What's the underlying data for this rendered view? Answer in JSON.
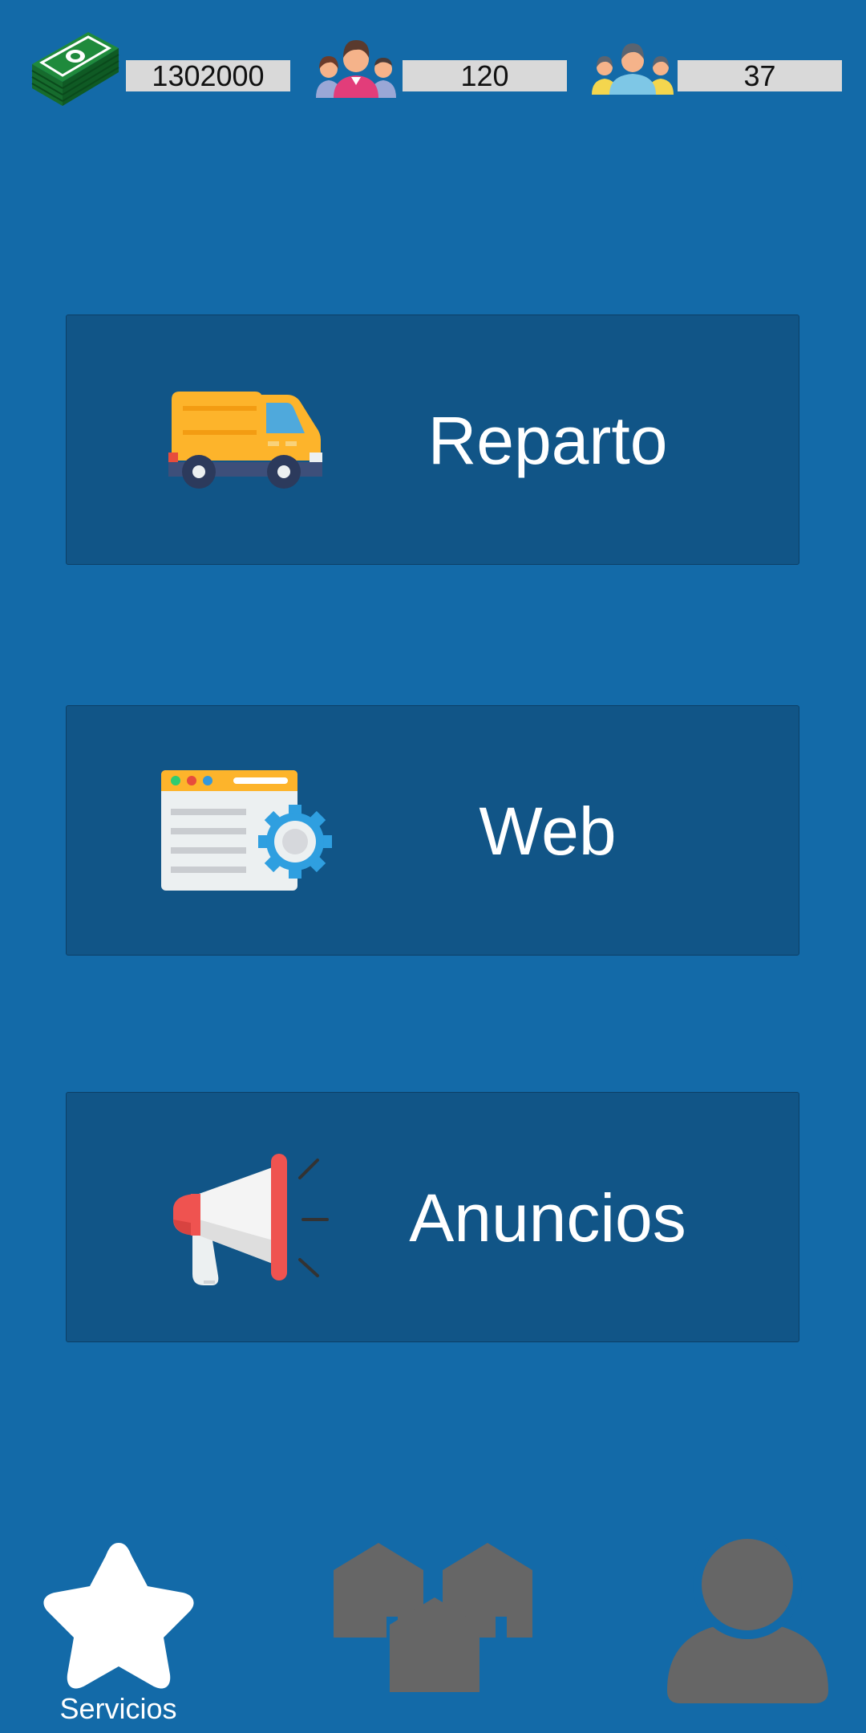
{
  "stats": {
    "money": {
      "value": "1302000",
      "icon": "money-stack-icon"
    },
    "employees": {
      "value": "120",
      "icon": "employees-icon"
    },
    "clients": {
      "value": "37",
      "icon": "clients-group-icon"
    }
  },
  "services": [
    {
      "label": "Reparto",
      "icon": "delivery-truck-icon"
    },
    {
      "label": "Web",
      "icon": "web-settings-icon"
    },
    {
      "label": "Anuncios",
      "icon": "megaphone-icon"
    }
  ],
  "nav": {
    "services": {
      "label": "Servicios",
      "icon": "star-icon",
      "active": true
    },
    "buildings": {
      "icon": "houses-icon"
    },
    "profile": {
      "icon": "user-icon"
    }
  },
  "colors": {
    "background": "#136aa8",
    "card": "#115587",
    "stat_box": "#d9d9d9",
    "nav_active": "#ffffff",
    "nav_inactive": "#666666"
  }
}
